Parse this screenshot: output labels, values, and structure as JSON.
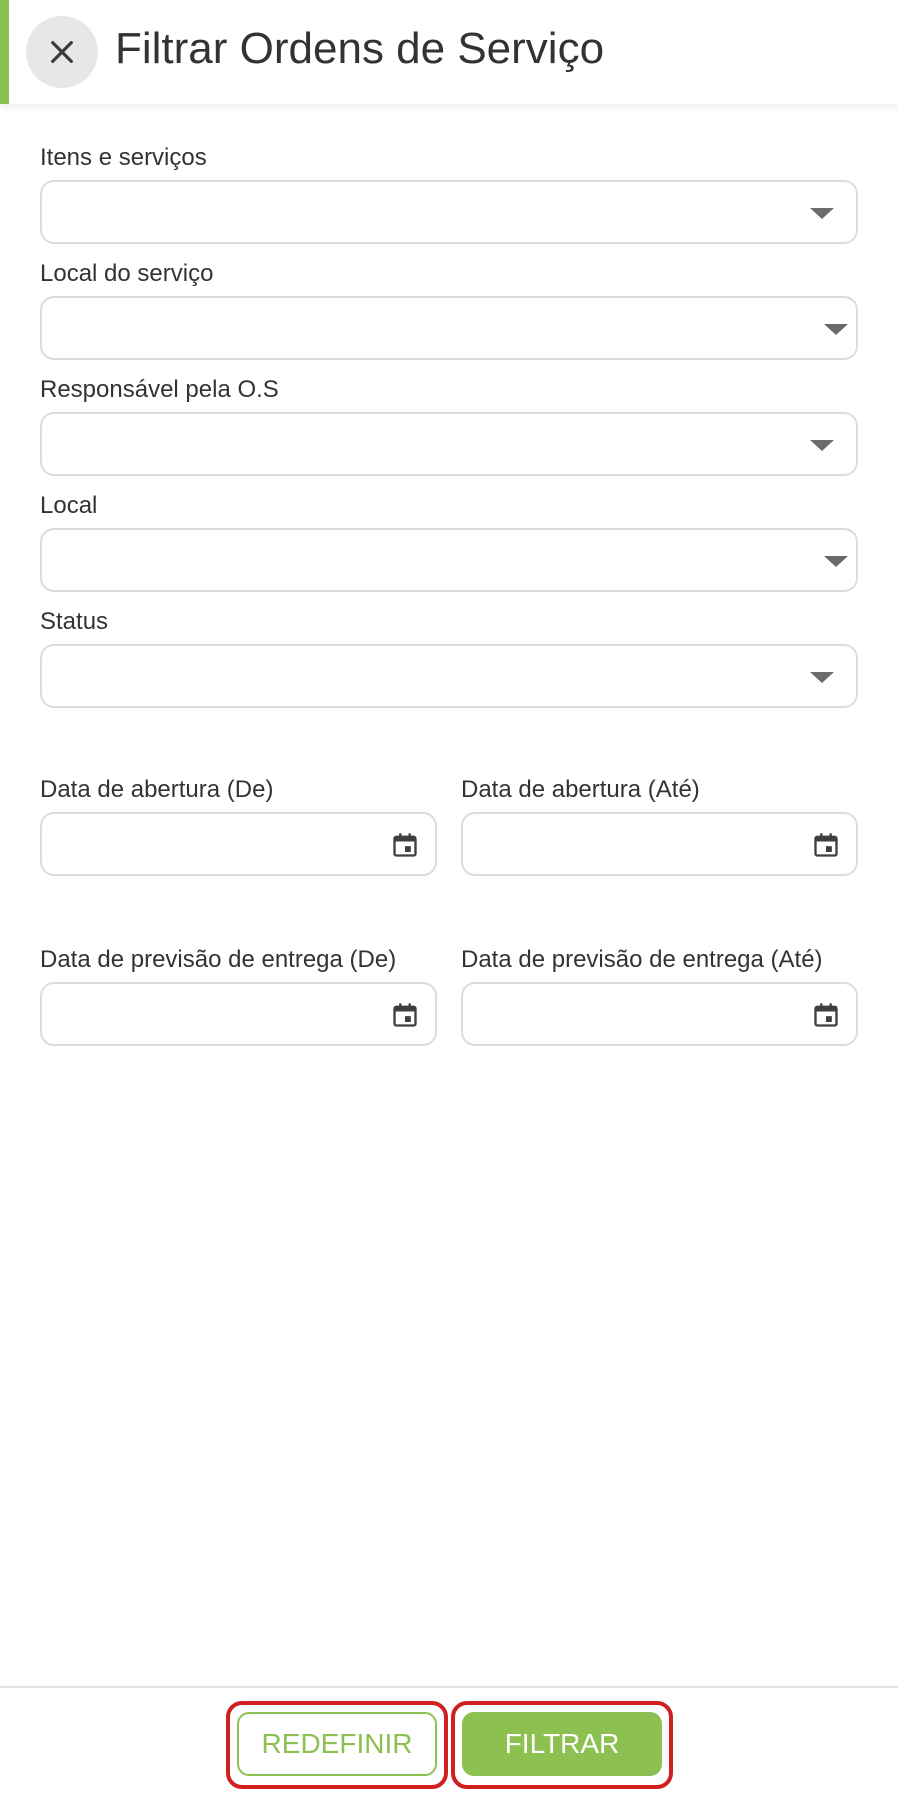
{
  "header": {
    "title": "Filtrar Ordens de Serviço",
    "close_icon": "close-icon"
  },
  "filters": {
    "itens_servicos": {
      "label": "Itens e serviços",
      "value": ""
    },
    "local_servico": {
      "label": "Local do serviço",
      "value": ""
    },
    "responsavel": {
      "label": "Responsável pela O.S",
      "value": ""
    },
    "local": {
      "label": "Local",
      "value": ""
    },
    "status": {
      "label": "Status",
      "value": ""
    },
    "abertura_de": {
      "label": "Data de abertura (De)",
      "value": ""
    },
    "abertura_ate": {
      "label": "Data de abertura (Até)",
      "value": ""
    },
    "previsao_de": {
      "label": "Data de previsão de entrega (De)",
      "value": ""
    },
    "previsao_ate": {
      "label": "Data de previsão de entrega (Até)",
      "value": ""
    }
  },
  "footer": {
    "reset_label": "REDEFINIR",
    "filter_label": "FILTRAR"
  },
  "colors": {
    "accent": "#8cc152",
    "highlight": "#d01f1f",
    "border": "#dcdcdc"
  },
  "icons": {
    "dropdown": "chevron-down-icon",
    "calendar": "calendar-icon"
  }
}
